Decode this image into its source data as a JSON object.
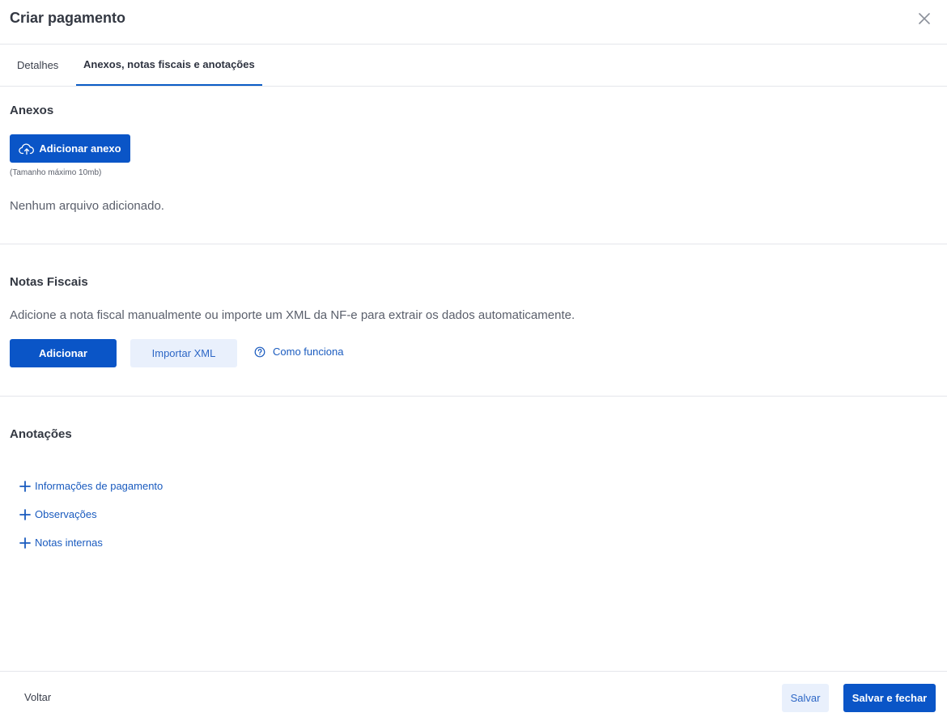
{
  "header": {
    "title": "Criar pagamento",
    "close_icon": "close-icon"
  },
  "tabs": [
    {
      "label": "Detalhes",
      "active": false
    },
    {
      "label": "Anexos, notas fiscais e anotações",
      "active": true
    }
  ],
  "attachments": {
    "title": "Anexos",
    "add_button_label": "Adicionar anexo",
    "add_button_icon": "cloud-upload-icon",
    "size_hint": "(Tamanho máximo 10mb)",
    "empty_text": "Nenhum arquivo adicionado."
  },
  "invoices": {
    "title": "Notas Fiscais",
    "description": "Adicione a nota fiscal manualmente ou importe um XML da NF-e para extrair os dados automaticamente.",
    "add_label": "Adicionar",
    "import_label": "Importar XML",
    "how_label": "Como funciona",
    "how_icon": "help-circle-icon"
  },
  "notes": {
    "title": "Anotações",
    "items": [
      {
        "label": "Informações de pagamento",
        "icon": "plus-icon"
      },
      {
        "label": "Observações",
        "icon": "plus-icon"
      },
      {
        "label": "Notas internas",
        "icon": "plus-icon"
      }
    ]
  },
  "footer": {
    "back_label": "Voltar",
    "save_label": "Salvar",
    "save_close_label": "Salvar e fechar"
  },
  "colors": {
    "primary": "#0a55c7",
    "secondary_bg": "#e9f0fc",
    "link": "#1a5bbf",
    "divider": "#e4e6eb"
  }
}
